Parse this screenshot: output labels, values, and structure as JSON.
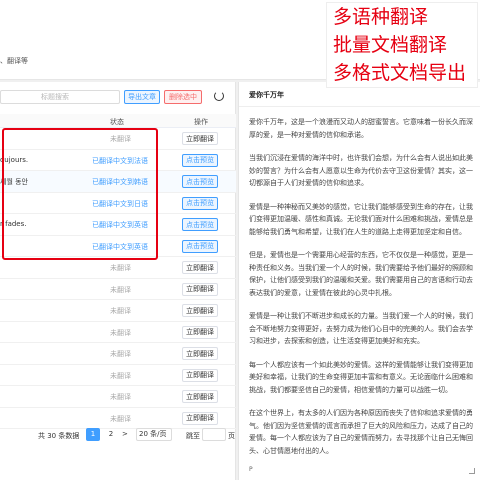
{
  "header": {
    "subtitle": "、翻译等"
  },
  "promo": {
    "line1": "多语种翻译",
    "line2": "批量文档翻译",
    "line3": "多格式文档导出"
  },
  "toolbar": {
    "search_placeholder": "标题搜索",
    "export_label": "导出文章",
    "delete_label": "删除选中"
  },
  "table": {
    "headers": {
      "status": "状态",
      "op": "操作"
    },
    "rows": [
      {
        "src": "",
        "status": "未翻译",
        "op": "立即翻译",
        "kind": "none"
      },
      {
        "src": "oujours.",
        "status": "已翻译中文到法语",
        "op": "点击预览",
        "kind": "done"
      },
      {
        "src": "세월 동안",
        "status": "已翻译中文到韩语",
        "op": "点击预览",
        "kind": "done"
      },
      {
        "src": "",
        "status": "已翻译中文到日语",
        "op": "点击预览",
        "kind": "done"
      },
      {
        "src": "r fades.",
        "status": "已翻译中文到英语",
        "op": "点击预览",
        "kind": "done"
      },
      {
        "src": "",
        "status": "已翻译中文到英语",
        "op": "点击预览",
        "kind": "done"
      },
      {
        "src": "",
        "status": "未翻译",
        "op": "立即翻译",
        "kind": "none"
      },
      {
        "src": "",
        "status": "未翻译",
        "op": "立即翻译",
        "kind": "none"
      },
      {
        "src": "",
        "status": "未翻译",
        "op": "立即翻译",
        "kind": "none"
      },
      {
        "src": "",
        "status": "未翻译",
        "op": "立即翻译",
        "kind": "none"
      },
      {
        "src": "",
        "status": "未翻译",
        "op": "立即翻译",
        "kind": "none"
      },
      {
        "src": "",
        "status": "未翻译",
        "op": "立即翻译",
        "kind": "none"
      },
      {
        "src": "",
        "status": "未翻译",
        "op": "立即翻译",
        "kind": "none"
      },
      {
        "src": "",
        "status": "未翻译",
        "op": "立即翻译",
        "kind": "none"
      }
    ]
  },
  "pager": {
    "total": "共 30 条数据",
    "page1": "1",
    "page2": "2",
    "next": ">",
    "size": "20 条/页",
    "jump": "跳至",
    "page_unit": "页"
  },
  "doc": {
    "title": "爱你千万年",
    "paragraphs": [
      "爱你千万年，这是一个浪漫而又动人的甜蜜誓言。它意味着一份长久而深厚的爱，是一种对爱情的信仰和承诺。",
      "当我们沉浸在爱情的海洋中时，也许我们会想，为什么会有人说出如此美妙的誓言？为什么会有人愿意以生命为代价去守卫这份爱情？其实，这一切都源自于人们对爱情的信仰和追求。",
      "爱情是一种神秘而又美妙的感觉，它让我们能够感受到生命的存在，让我们变得更加温暖、感性和真诚。无论我们面对什么困难和挑战，爱情总是能够给我们勇气和希望，让我们在人生的道路上走得更加坚定和自信。",
      "但是，爱情也是一个需要用心经营的东西，它不仅仅是一种感觉，更是一种责任和义务。当我们爱一个人的时候，我们需要给予他们最好的照顾和保护，让他们感受到我们的温暖和关爱。我们需要用自己的言语和行动去表达我们的爱意，让爱情在彼此的心灵中扎根。",
      "爱情是一种让我们不断进步和成长的力量。当我们爱一个人的时候，我们会不断地努力变得更好，去努力成为他们心目中的完美的人。我们会去学习和进步，去探索和创造，让生活变得更加美好和充实。",
      "每一个人都应该有一个如此美妙的爱情。这样的爱情能够让我们变得更加美好和幸福，让我们的生命变得更加丰富和有意义。无论面临什么困难和挑战，我们都要坚信自己的爱情，相信爱情的力量可以战胜一切。",
      "在这个世界上，有太多的人们因为各种原因而丧失了信仰和追求爱情的勇气。他们因为坚信爱情的谎言而承担了巨大的风险和压力，达成了自己的爱情。每一个人都应该为了自己的爱情而努力，去寻找那个让自己无悔回头、心甘情愿地付出的人。"
    ],
    "status_line": "P"
  }
}
